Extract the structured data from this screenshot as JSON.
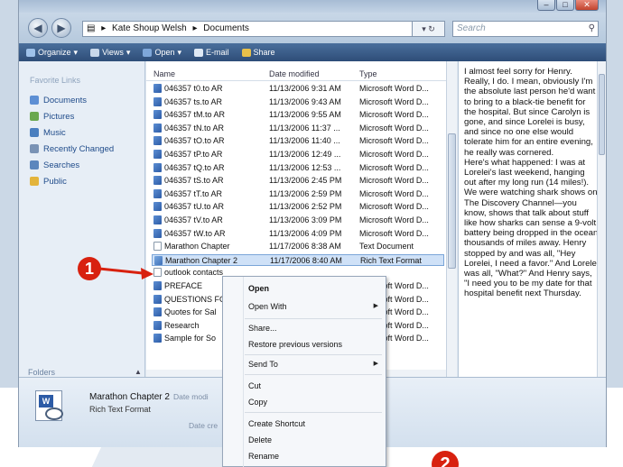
{
  "address": {
    "segments": [
      "Kate Shoup Welsh",
      "Documents"
    ],
    "refresh_label": "• »"
  },
  "search": {
    "placeholder": "Search"
  },
  "toolbar": {
    "organize": "Organize",
    "views": "Views",
    "open": "Open",
    "email": "E-mail",
    "share": "Share"
  },
  "nav": {
    "header": "Favorite Links",
    "items": [
      {
        "label": "Documents",
        "icon": "documents-folder-icon",
        "color": "#5d8fd4"
      },
      {
        "label": "Pictures",
        "icon": "pictures-folder-icon",
        "color": "#6aa84f"
      },
      {
        "label": "Music",
        "icon": "music-folder-icon",
        "color": "#4a7fbf"
      },
      {
        "label": "Recently Changed",
        "icon": "recent-folder-icon",
        "color": "#7a93b5"
      },
      {
        "label": "Searches",
        "icon": "searches-folder-icon",
        "color": "#5b86bd"
      },
      {
        "label": "Public",
        "icon": "public-folder-icon",
        "color": "#e3b43c"
      }
    ],
    "folders_label": "Folders"
  },
  "columns": {
    "name": "Name",
    "date": "Date modified",
    "type": "Type"
  },
  "files": [
    {
      "name": "046357 t0.to AR",
      "date": "11/13/2006 9:31 AM",
      "type": "Microsoft Word D...",
      "kind": "word"
    },
    {
      "name": "046357 ts.to AR",
      "date": "11/13/2006 9:43 AM",
      "type": "Microsoft Word D...",
      "kind": "word"
    },
    {
      "name": "046357 tM.to AR",
      "date": "11/13/2006 9:55 AM",
      "type": "Microsoft Word D...",
      "kind": "word"
    },
    {
      "name": "046357 tN.to AR",
      "date": "11/13/2006 11:37 ...",
      "type": "Microsoft Word D...",
      "kind": "word"
    },
    {
      "name": "046357 tO.to AR",
      "date": "11/13/2006 11:40 ...",
      "type": "Microsoft Word D...",
      "kind": "word"
    },
    {
      "name": "046357 tP.to AR",
      "date": "11/13/2006 12:49 ...",
      "type": "Microsoft Word D...",
      "kind": "word"
    },
    {
      "name": "046357 tQ.to AR",
      "date": "11/13/2006 12:53 ...",
      "type": "Microsoft Word D...",
      "kind": "word"
    },
    {
      "name": "046357 tS.to AR",
      "date": "11/13/2006 2:45 PM",
      "type": "Microsoft Word D...",
      "kind": "word"
    },
    {
      "name": "046357 tT.to AR",
      "date": "11/13/2006 2:59 PM",
      "type": "Microsoft Word D...",
      "kind": "word"
    },
    {
      "name": "046357 tU.to AR",
      "date": "11/13/2006 2:52 PM",
      "type": "Microsoft Word D...",
      "kind": "word"
    },
    {
      "name": "046357 tV.to AR",
      "date": "11/13/2006 3:09 PM",
      "type": "Microsoft Word D...",
      "kind": "word"
    },
    {
      "name": "046357 tW.to AR",
      "date": "11/13/2006 4:09 PM",
      "type": "Microsoft Word D...",
      "kind": "word"
    },
    {
      "name": "Marathon Chapter",
      "date": "11/17/2006 8:38 AM",
      "type": "Text Document",
      "kind": "txt"
    },
    {
      "name": "Marathon Chapter 2",
      "date": "11/17/2006 8:40 AM",
      "type": "Rich Text Format",
      "kind": "rtf",
      "selected": true
    },
    {
      "name": "outlook contacts",
      "date": "",
      "type": "",
      "kind": "txt"
    },
    {
      "name": "PREFACE",
      "date": "",
      "type": "Microsoft Word D...",
      "kind": "word"
    },
    {
      "name": "QUESTIONS FOR",
      "date": "",
      "type": "Microsoft Word D...",
      "kind": "word"
    },
    {
      "name": "Quotes for Sal",
      "date": "",
      "type": "Microsoft Word D...",
      "kind": "word"
    },
    {
      "name": "Research",
      "date": "",
      "type": "Microsoft Word D...",
      "kind": "word"
    },
    {
      "name": "Sample for So",
      "date": "",
      "type": "Microsoft Word D...",
      "kind": "word"
    }
  ],
  "preview": {
    "paragraphs": [
      "I almost feel sorry for Henry. Really, I do. I mean, obviously I'm the absolute last person he'd want to bring to a black-tie benefit for the hospital. But since Carolyn is gone, and since Lorelei is busy, and since no one else would tolerate him for an entire evening, he really was cornered.",
      "Here's what happened: I was at Lorelei's last weekend, hanging out after my long run (14 miles!). We were watching shark shows on The Discovery Channel—you know, shows that talk about stuff like how sharks can sense a 9-volt battery being dropped in the ocean thousands of miles away. Henry stopped by and was all, \"Hey Lorelei, I need a favor.\" And Lorelei was all, \"What?\" And Henry says, \"I need you to be my date for that hospital benefit next Thursday."
    ]
  },
  "details": {
    "name": "Marathon Chapter 2",
    "date_label": "Date modi",
    "type": "Rich Text Format",
    "created_label": "Date cre"
  },
  "context_menu": {
    "items": [
      "Open",
      "Open With",
      "Share...",
      "Restore previous versions",
      "Send To",
      "Cut",
      "Copy",
      "Create Shortcut",
      "Delete",
      "Rename"
    ]
  },
  "callouts": {
    "one": "1",
    "two": "2"
  },
  "colors": {
    "callout": "#d8210f",
    "toolbar": "#3a5d8c",
    "selection": "#cfe1f7"
  }
}
